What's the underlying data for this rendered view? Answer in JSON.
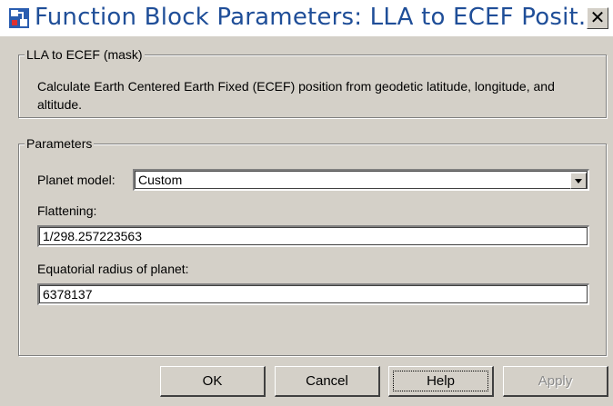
{
  "window": {
    "title": "Function Block Parameters: LLA to ECEF Posit...",
    "close_symbol": "✕"
  },
  "mask_group": {
    "legend": "LLA to ECEF (mask)",
    "description": "Calculate Earth Centered Earth Fixed (ECEF) position from geodetic latitude, longitude, and altitude."
  },
  "parameters_group": {
    "legend": "Parameters",
    "planet_model_label": "Planet model:",
    "planet_model_value": "Custom",
    "flattening_label": "Flattening:",
    "flattening_value": "1/298.257223563",
    "radius_label": "Equatorial radius of planet:",
    "radius_value": "6378137"
  },
  "buttons": {
    "ok": "OK",
    "cancel": "Cancel",
    "help": "Help",
    "apply": "Apply"
  },
  "icons": {
    "app": "simulink-block-icon",
    "close": "close-icon",
    "dropdown": "chevron-down-icon"
  }
}
